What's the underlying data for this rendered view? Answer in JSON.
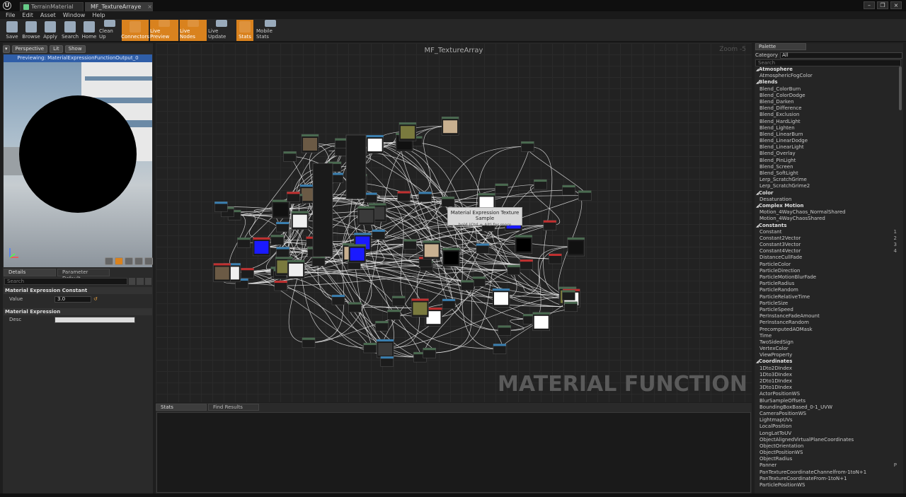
{
  "tabs": [
    {
      "label": "TerrainMaterial",
      "active": false
    },
    {
      "label": "MF_TextureArraye",
      "active": true
    }
  ],
  "window_buttons": [
    "–",
    "❐",
    "×"
  ],
  "menu": [
    "File",
    "Edit",
    "Asset",
    "Window",
    "Help"
  ],
  "toolbar": [
    {
      "label": "Save",
      "icon": "save-icon",
      "on": false
    },
    {
      "label": "Browse",
      "icon": "browse-icon",
      "on": false
    },
    {
      "label": "Apply",
      "icon": "apply-icon",
      "on": false
    },
    {
      "label": "Search",
      "icon": "search-icon",
      "on": false
    },
    {
      "label": "Home",
      "icon": "home-icon",
      "on": false
    },
    {
      "label": "Clean Up",
      "icon": "clean-up-icon",
      "on": false
    },
    {
      "label": "Connectors",
      "icon": "connectors-icon",
      "on": true
    },
    {
      "label": "Live Preview",
      "icon": "live-preview-icon",
      "on": true
    },
    {
      "label": "Live Nodes",
      "icon": "live-nodes-icon",
      "on": true
    },
    {
      "label": "Live Update",
      "icon": "live-update-icon",
      "on": false
    },
    {
      "label": "Stats",
      "icon": "stats-icon",
      "on": true
    },
    {
      "label": "Mobile Stats",
      "icon": "mobile-stats-icon",
      "on": false
    }
  ],
  "viewport": {
    "buttons": [
      "Perspective",
      "Lit",
      "Show"
    ],
    "preview_text": "Previewing: MaterialExpressionFunctionOutput_0"
  },
  "details": {
    "tabs": [
      "Details",
      "Parameter Default"
    ],
    "search_placeholder": "Search",
    "section1": "Material Expression Constant",
    "value_label": "Value",
    "value": "3.0",
    "section2": "Material Expression",
    "desc_label": "Desc"
  },
  "graph": {
    "title": "MF_TextureArray",
    "zoom": "Zoom -5",
    "watermark": "MATERIAL FUNCTION",
    "tooltip_title": "Material Expression Texture Sample",
    "tooltip_hint": "hold (Ctrl + Alt) for more"
  },
  "bottom_tabs": [
    "Stats",
    "Find Results"
  ],
  "palette": {
    "tab": "Palette",
    "category_label": "Category",
    "category_value": "All",
    "search_placeholder": "Search",
    "items": [
      {
        "t": "Atmosphere",
        "cat": true
      },
      {
        "t": "AtmosphericFogColor"
      },
      {
        "t": "Blends",
        "cat": true
      },
      {
        "t": "Blend_ColorBurn"
      },
      {
        "t": "Blend_ColorDodge"
      },
      {
        "t": "Blend_Darken"
      },
      {
        "t": "Blend_Difference"
      },
      {
        "t": "Blend_Exclusion"
      },
      {
        "t": "Blend_HardLight"
      },
      {
        "t": "Blend_Lighten"
      },
      {
        "t": "Blend_LinearBurn"
      },
      {
        "t": "Blend_LinearDodge"
      },
      {
        "t": "Blend_LinearLight"
      },
      {
        "t": "Blend_Overlay"
      },
      {
        "t": "Blend_PinLight"
      },
      {
        "t": "Blend_Screen"
      },
      {
        "t": "Blend_SoftLight"
      },
      {
        "t": "Lerp_ScratchGrime"
      },
      {
        "t": "Lerp_ScratchGrime2"
      },
      {
        "t": "Color",
        "cat": true
      },
      {
        "t": "Desaturation"
      },
      {
        "t": "Complex Motion",
        "cat": true
      },
      {
        "t": "Motion_4WayChaos_NormalShared"
      },
      {
        "t": "Motion_4WayChaosShared"
      },
      {
        "t": "Constants",
        "cat": true
      },
      {
        "t": "Constant",
        "hk": "1"
      },
      {
        "t": "Constant2Vector",
        "hk": "2"
      },
      {
        "t": "Constant3Vector",
        "hk": "3"
      },
      {
        "t": "Constant4Vector",
        "hk": "4"
      },
      {
        "t": "DistanceCullFade"
      },
      {
        "t": "ParticleColor"
      },
      {
        "t": "ParticleDirection"
      },
      {
        "t": "ParticleMotionBlurFade"
      },
      {
        "t": "ParticleRadius"
      },
      {
        "t": "ParticleRandom"
      },
      {
        "t": "ParticleRelativeTime"
      },
      {
        "t": "ParticleSize"
      },
      {
        "t": "ParticleSpeed"
      },
      {
        "t": "PerInstanceFadeAmount"
      },
      {
        "t": "PerInstanceRandom"
      },
      {
        "t": "PrecomputedAOMask"
      },
      {
        "t": "Time"
      },
      {
        "t": "TwoSidedSign"
      },
      {
        "t": "VertexColor"
      },
      {
        "t": "ViewProperty"
      },
      {
        "t": "Coordinates",
        "cat": true
      },
      {
        "t": "1Dto2DIndex"
      },
      {
        "t": "1Dto3DIndex"
      },
      {
        "t": "2Dto1DIndex"
      },
      {
        "t": "3Dto1DIndex"
      },
      {
        "t": "ActorPositionWS"
      },
      {
        "t": "BlurSampleOffsets"
      },
      {
        "t": "BoundingBoxBased_0-1_UVW"
      },
      {
        "t": "CameraPositionWS"
      },
      {
        "t": "LightmapUVs"
      },
      {
        "t": "LocalPosition"
      },
      {
        "t": "LongLatToUV"
      },
      {
        "t": "ObjectAlignedVirtualPlaneCoordinates"
      },
      {
        "t": "ObjectOrientation"
      },
      {
        "t": "ObjectPositionWS"
      },
      {
        "t": "ObjectRadius"
      },
      {
        "t": "Panner",
        "hk": "P"
      },
      {
        "t": "PanTextureCoordinateChannelfrom-1toN+1"
      },
      {
        "t": "PanTextureCoordinateFrom-1toN+1"
      },
      {
        "t": "ParticlePositionWS"
      }
    ]
  }
}
